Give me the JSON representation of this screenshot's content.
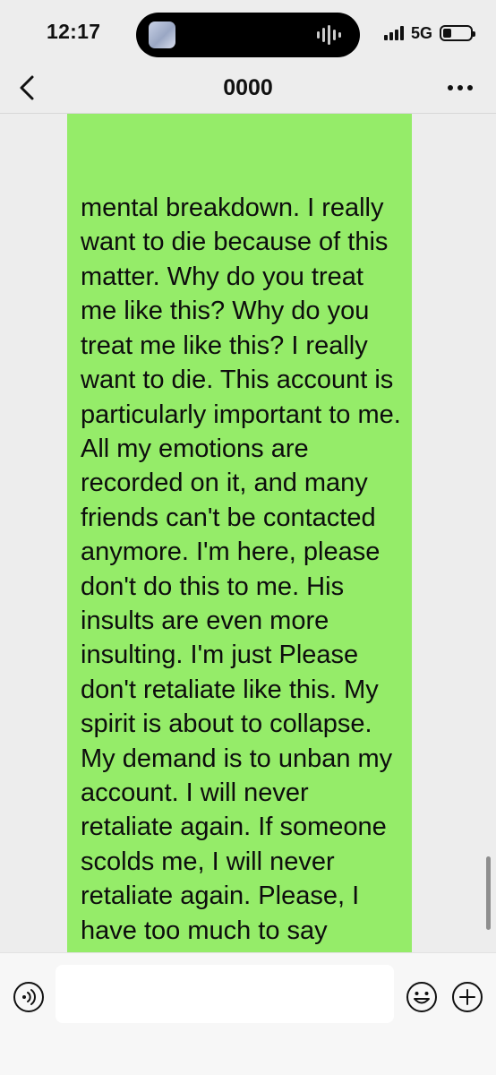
{
  "status_bar": {
    "time": "12:17",
    "network": "5G",
    "signal_bars": 4,
    "battery_level": 0.3
  },
  "nav": {
    "title": "0000",
    "back_icon": "chevron-left-icon",
    "more_icon": "more-dots-icon"
  },
  "messages": [
    {
      "side": "sent",
      "bubble_color": "#95ec69",
      "text": "mental breakdown. I really want to die because of this matter. Why do you treat me like this? Why do you treat me like this? I really want to die. This account is particularly important to me. All my emotions are recorded on it, and many friends can't be contacted anymore. I'm here, please don't do this to me. His insults are even more insulting. I'm just Please don't retaliate like this. My spirit is about to collapse. My demand is to unban my account. I will never retaliate again. If someone scolds me, I will never retaliate again. Please, I have too much to say"
    }
  ],
  "input_bar": {
    "value": "",
    "voice_icon": "voice-icon",
    "emoji_icon": "emoji-icon",
    "plus_icon": "plus-icon"
  },
  "colors": {
    "background": "#ededed",
    "sent_bubble": "#95ec69",
    "input_bar": "#f7f7f7"
  }
}
